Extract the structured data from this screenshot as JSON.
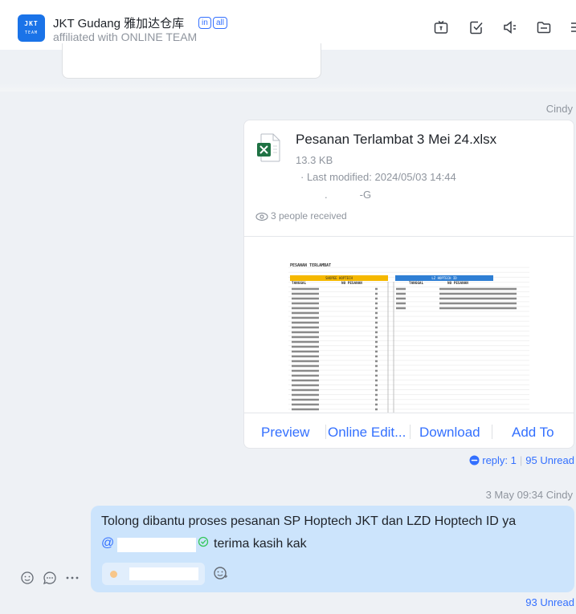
{
  "header": {
    "logo_line1": "JKT",
    "logo_line2": "TEAM",
    "title": "JKT Gudang 雅加达仓库",
    "tag_internal": "in",
    "tag_all": "all",
    "subtitle": "affiliated with ONLINE TEAM",
    "icons": [
      "tv-icon",
      "checkbox-icon",
      "announcement-icon",
      "folder-icon",
      "more-icon"
    ]
  },
  "file_message": {
    "sender": "Cindy",
    "file_name": "Pesanan Terlambat 3 Mei 24.xlsx",
    "file_size": "13.3 KB",
    "last_modified": "· Last modified: 2024/05/03 14:44",
    "modifier_prefix": ".",
    "modifier_suffix": "-G",
    "received": "3 people received",
    "preview_sheet": {
      "title": "PESANAN TERLAMBAT",
      "left_header": "SHOPEE HOPTECH",
      "right_header": "LZ HOPTECH ID",
      "left_cols": [
        "TANGGAL",
        "NO PESANAN"
      ],
      "right_cols": [
        "TANGGAL",
        "NO PESANAN"
      ]
    },
    "actions": [
      "Preview",
      "Online Edit...",
      "Download",
      "Add To"
    ],
    "reply_label": "reply: 1",
    "unread": "95 Unread"
  },
  "text_message": {
    "time": "3 May 09:34",
    "sender": "Cindy",
    "line1": "Tolong dibantu proses pesanan SP Hoptech JKT dan LZD Hoptech ID ya",
    "mention": "@",
    "line2": "terima kasih kak",
    "unread": "93 Unread"
  },
  "colors": {
    "accent": "#3370ff",
    "bubble": "#cce4fc",
    "excel_green": "#1f7244",
    "background": "#eef1f5"
  }
}
